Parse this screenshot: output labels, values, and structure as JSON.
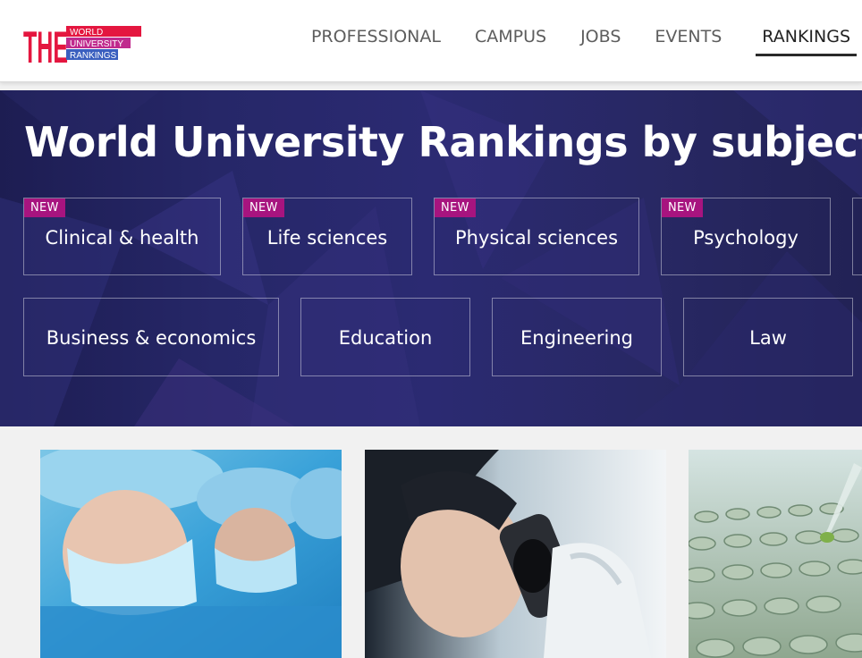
{
  "header": {
    "logo": {
      "mark": "THE",
      "lines": [
        "WORLD",
        "UNIVERSITY",
        "RANKINGS"
      ]
    },
    "nav": [
      {
        "label": "PROFESSIONAL"
      },
      {
        "label": "CAMPUS"
      },
      {
        "label": "JOBS"
      },
      {
        "label": "EVENTS"
      },
      {
        "label": "RANKINGS",
        "active": true
      }
    ]
  },
  "hero": {
    "title": "World University Rankings by subject",
    "new_subjects": [
      {
        "label": "Clinical & health",
        "badge": "NEW"
      },
      {
        "label": "Life sciences",
        "badge": "NEW"
      },
      {
        "label": "Physical sciences",
        "badge": "NEW"
      },
      {
        "label": "Psychology",
        "badge": "NEW"
      }
    ],
    "subjects": [
      {
        "label": "Business & economics"
      },
      {
        "label": "Education"
      },
      {
        "label": "Engineering"
      },
      {
        "label": "Law"
      }
    ]
  },
  "cards": [
    {
      "image": "surgeons-photo"
    },
    {
      "image": "microscope-photo"
    },
    {
      "image": "lab-plate-pipette-photo"
    }
  ],
  "colors": {
    "badge": "#a7147f",
    "hero_bg": "#262768",
    "logo_red": "#e4163f",
    "logo_magenta": "#c02a8d",
    "logo_blue": "#3a5fbf"
  }
}
